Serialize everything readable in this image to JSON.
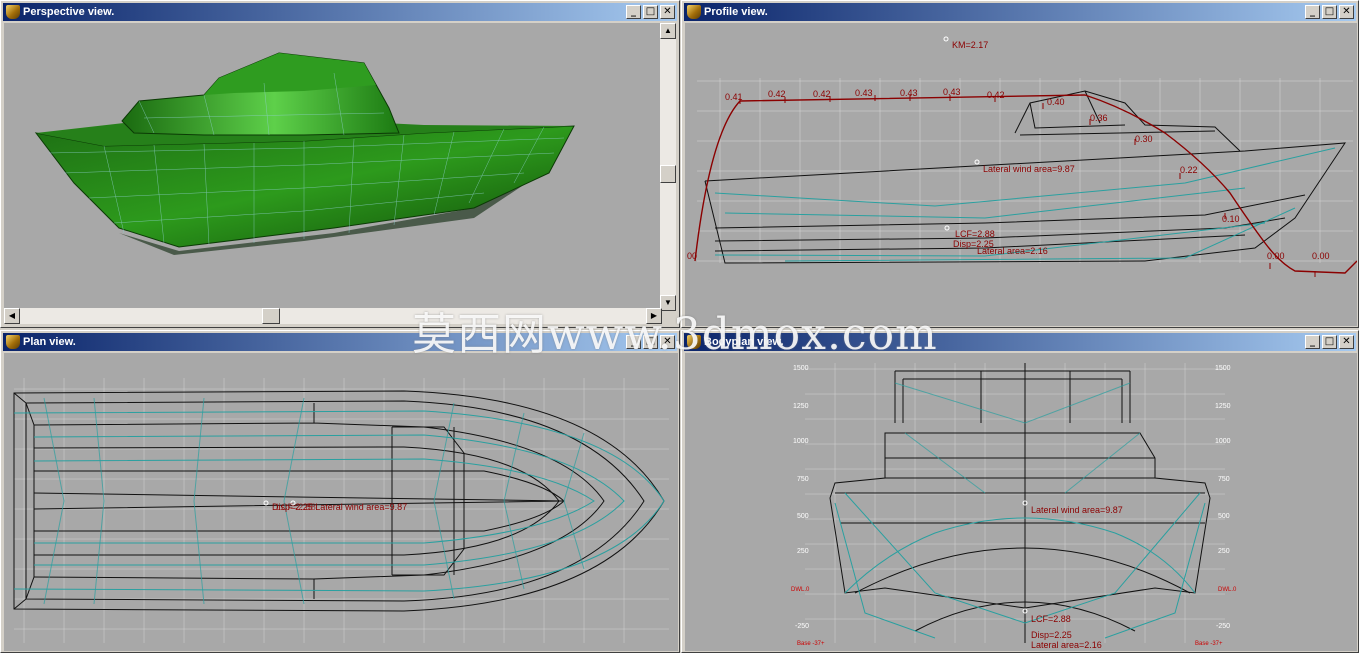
{
  "windows": {
    "perspective": {
      "title": "Perspective view."
    },
    "profile": {
      "title": "Profile view."
    },
    "plan": {
      "title": "Plan view."
    },
    "bodyplan": {
      "title": "Bodyplan view."
    }
  },
  "title_buttons": {
    "minimize": "_",
    "maximize": "□",
    "close": "✕"
  },
  "profile": {
    "curve_labels": [
      "0.41",
      "0.42",
      "0.42",
      "0.43",
      "0.43",
      "0.43",
      "0.42",
      "0.40",
      "0.36",
      "0.30",
      "0.22",
      "0.10",
      "0.00",
      "0.00",
      "00"
    ],
    "km": "KM=2.17",
    "lateral_wind_area": "Lateral wind area=9.87",
    "lcf": "LCF=2.88",
    "disp": "Disp=2.25",
    "lateral_area": "Lateral area=2.16"
  },
  "plan": {
    "overlap_label": "Disp=2.25 Lateral wind area=9.87",
    "overlap_label_b": "LCF=2.88"
  },
  "bodyplan": {
    "left_ticks": [
      "1500",
      "1250",
      "1000",
      "750",
      "500",
      "250",
      "DWL.0",
      "-250",
      "Base -37+"
    ],
    "right_ticks": [
      "1500",
      "1250",
      "1000",
      "750",
      "500",
      "250",
      "DWL.0",
      "-250",
      "Base -37+"
    ],
    "lateral_wind_area": "Lateral wind area=9.87",
    "lcf": "LCF=2.88",
    "disp": "Disp=2.25",
    "lateral_area": "Lateral area=2.16"
  },
  "scrollbar_arrows": {
    "up": "▲",
    "down": "▼",
    "left": "◀",
    "right": "▶"
  },
  "watermark": "莫西网www.3dmox.com",
  "colors": {
    "hull_green": "#2e8b1e",
    "wire_cyan": "#3aa8a8",
    "curve_red": "#8b0000",
    "viewport_bg": "#a8a8a8",
    "title_blue": "#0a246a"
  }
}
